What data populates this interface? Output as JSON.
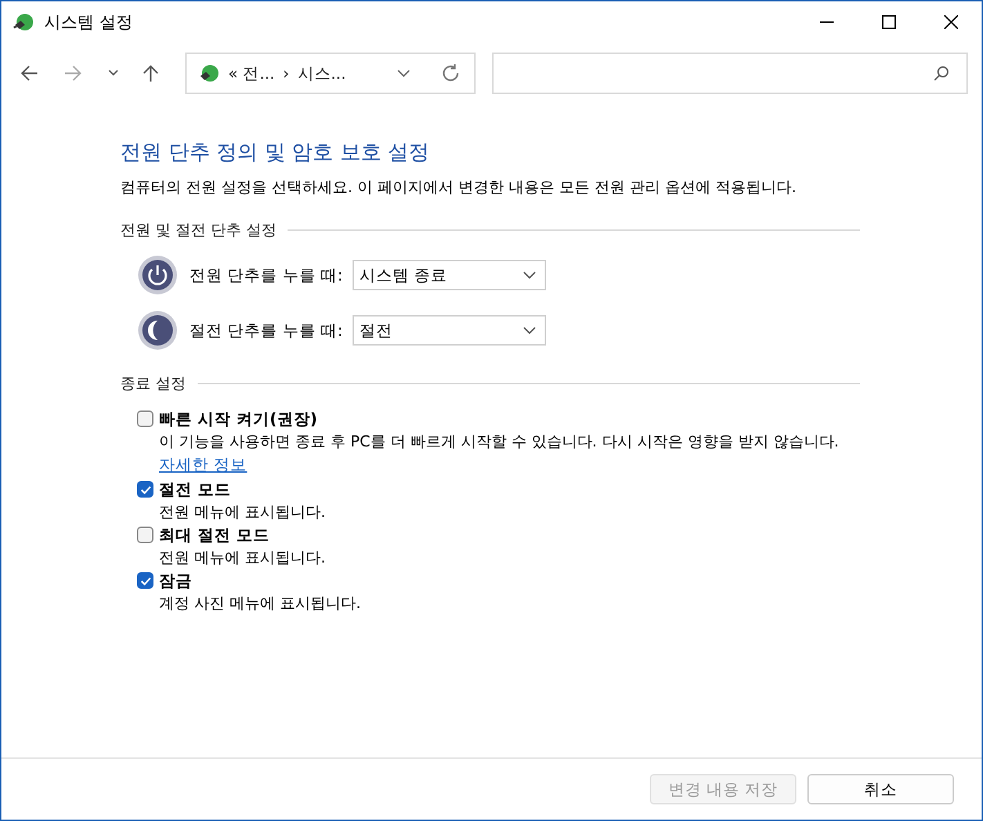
{
  "window": {
    "title": "시스템 설정"
  },
  "address_bar": {
    "crumbs": [
      "« 전...",
      "›",
      "시스..."
    ]
  },
  "heading": "전원 단추 정의 및 암호 보호 설정",
  "description": "컴퓨터의 전원 설정을 선택하세요. 이 페이지에서 변경한 내용은 모든 전원 관리 옵션에 적용됩니다.",
  "button_section": {
    "title": "전원 및 절전 단추 설정",
    "rows": [
      {
        "kind": "power",
        "label": "전원 단추를 누를 때:",
        "value": "시스템 종료"
      },
      {
        "kind": "sleep",
        "label": "절전 단추를 누를 때:",
        "value": "절전"
      }
    ]
  },
  "shutdown_section": {
    "title": "종료 설정",
    "options": [
      {
        "label": "빠른 시작 켜기(권장)",
        "checked": false,
        "description": "이 기능을 사용하면 종료 후 PC를 더 빠르게 시작할 수 있습니다. 다시 시작은 영향을 받지 않습니다.",
        "link": "자세한 정보"
      },
      {
        "label": "절전 모드",
        "checked": true,
        "description": "전원 메뉴에 표시됩니다."
      },
      {
        "label": "최대 절전 모드",
        "checked": false,
        "description": "전원 메뉴에 표시됩니다."
      },
      {
        "label": "잠금",
        "checked": true,
        "description": "계정 사진 메뉴에 표시됩니다."
      }
    ]
  },
  "buttons": [
    {
      "label": "변경 내용 저장",
      "disabled": true
    },
    {
      "label": "취소",
      "disabled": false
    }
  ]
}
